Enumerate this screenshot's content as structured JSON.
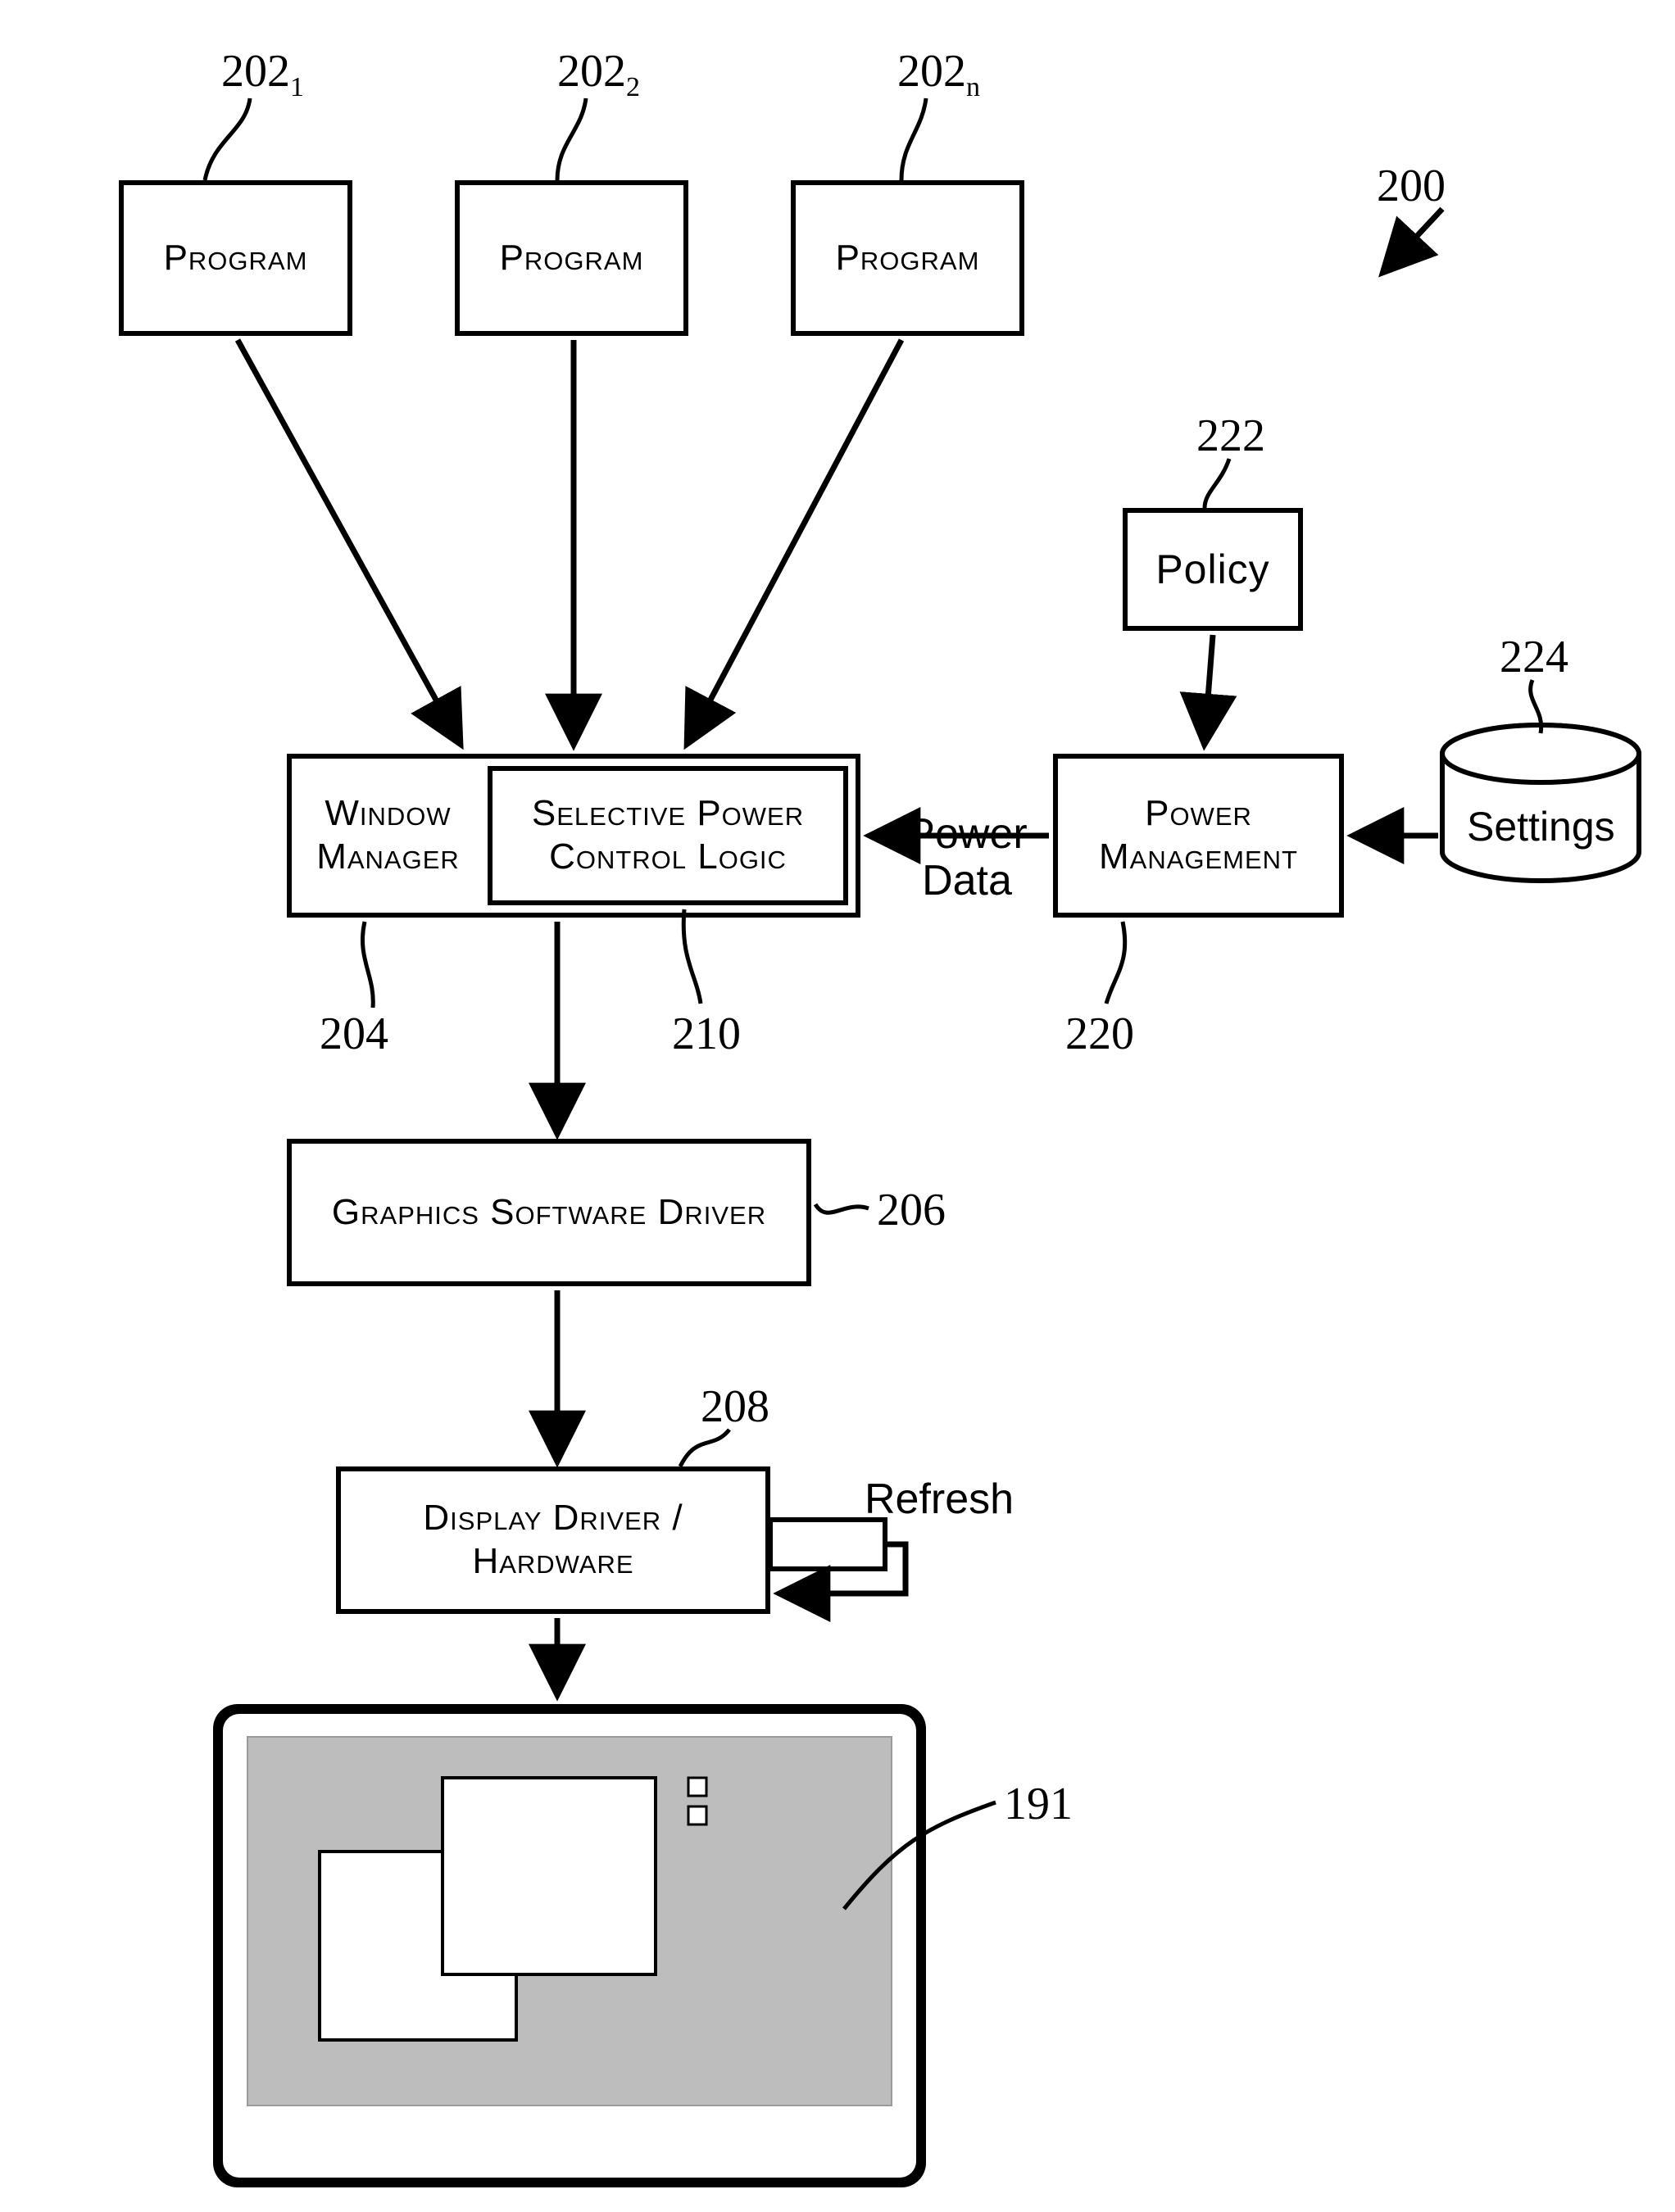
{
  "refs": {
    "program1": {
      "main": "202",
      "sub": "1"
    },
    "program2": {
      "main": "202",
      "sub": "2"
    },
    "programN": {
      "main": "202",
      "sub": "n"
    },
    "system": "200",
    "policy": "222",
    "settings": "224",
    "windowManager": "204",
    "selectivePower": "210",
    "powerMgmt": "220",
    "graphicsDriver": "206",
    "displayDriver": "208",
    "monitor": "191"
  },
  "boxes": {
    "program": "Program",
    "windowManager": "Window Manager",
    "selectivePower": "Selective Power Control Logic",
    "powerMgmt": "Power Management",
    "policy": "Policy",
    "settings": "Settings",
    "graphicsDriver": "Graphics Software Driver",
    "displayDriver": "Display Driver / Hardware"
  },
  "labels": {
    "powerData": "Power Data",
    "refresh": "Refresh"
  }
}
